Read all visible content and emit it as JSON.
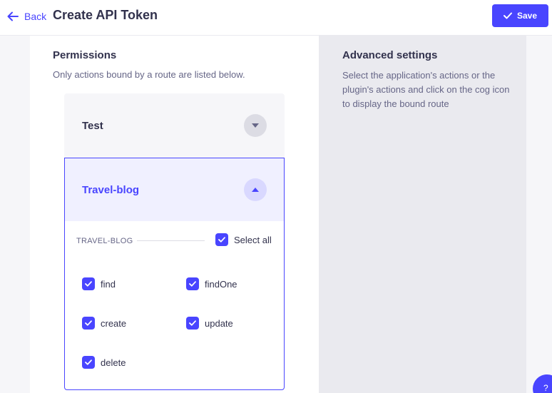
{
  "header": {
    "back_label": "Back",
    "title": "Create API Token",
    "save_label": "Save"
  },
  "permissions": {
    "title": "Permissions",
    "subtitle": "Only actions bound by a route are listed below.",
    "accordions": [
      {
        "label": "Test",
        "expanded": false
      },
      {
        "label": "Travel-blog",
        "expanded": true,
        "section_label": "TRAVEL-BLOG",
        "select_all": {
          "label": "Select all",
          "checked": true
        },
        "actions": [
          {
            "label": "find",
            "checked": true
          },
          {
            "label": "findOne",
            "checked": true
          },
          {
            "label": "create",
            "checked": true
          },
          {
            "label": "update",
            "checked": true
          },
          {
            "label": "delete",
            "checked": true
          }
        ]
      }
    ]
  },
  "advanced": {
    "title": "Advanced settings",
    "description": "Select the application's actions or the plugin's actions and click on the cog icon to display the bound route"
  },
  "help": {
    "label": "?"
  },
  "colors": {
    "primary": "#4945ff",
    "primary_light": "#f0f0ff",
    "neutral_bg": "#f6f6f9",
    "panel_bg": "#eaeaef",
    "text": "#32324d",
    "text_muted": "#666687"
  }
}
